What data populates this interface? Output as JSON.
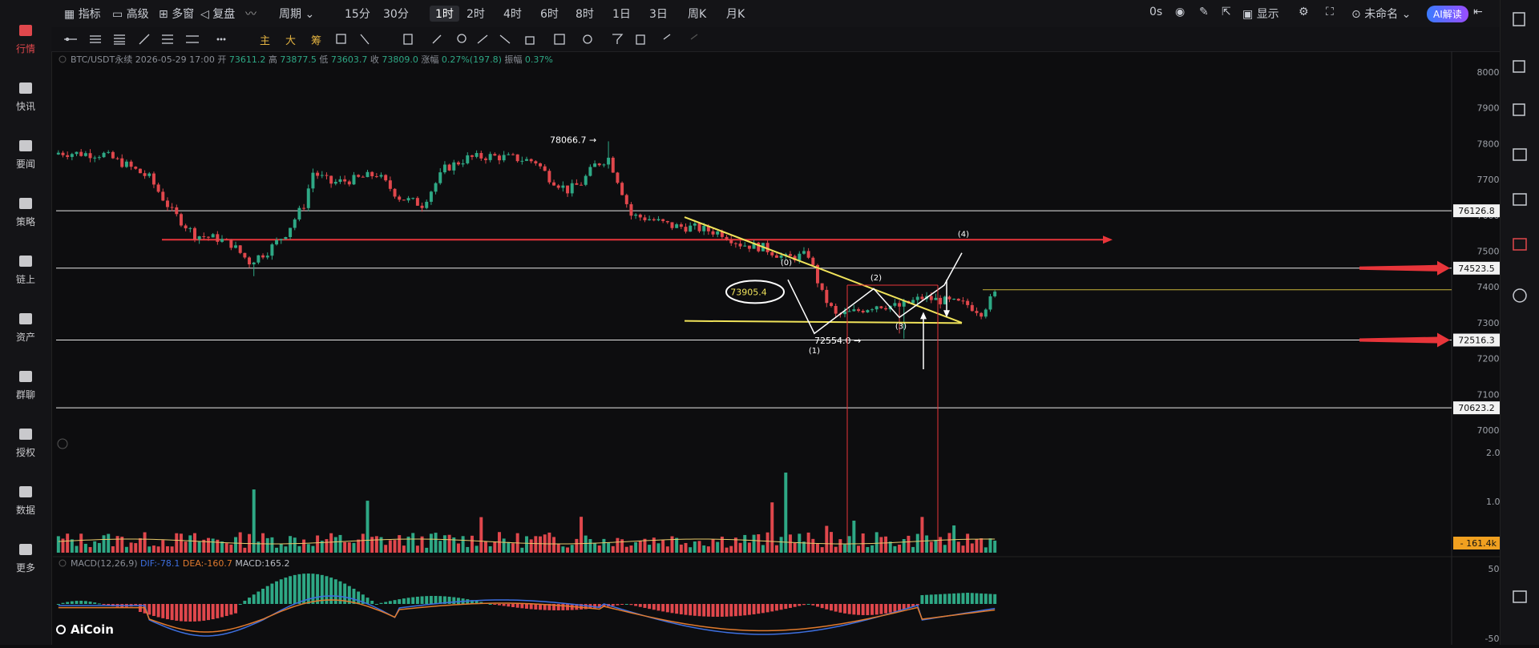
{
  "topbar": {
    "indicators": "指标",
    "advanced": "高级",
    "multi_window": "多窗",
    "replay": "复盘",
    "period_label": "周期",
    "periods": [
      "15分",
      "30分",
      "1时",
      "2时",
      "4时",
      "6时",
      "8时",
      "1日",
      "3日",
      "周K",
      "月K"
    ],
    "selected_period": "1时",
    "time_zero": "0s",
    "display": "显示",
    "unnamed": "未命名",
    "ai_read": "AI解读"
  },
  "nav": [
    {
      "label": "行情",
      "icon": "chart-bars-icon"
    },
    {
      "label": "快讯",
      "icon": "news-flash-icon"
    },
    {
      "label": "要闻",
      "icon": "document-icon"
    },
    {
      "label": "策略",
      "icon": "robot-icon"
    },
    {
      "label": "链上",
      "icon": "chain-icon"
    },
    {
      "label": "资产",
      "icon": "wallet-icon"
    },
    {
      "label": "群聊",
      "icon": "chat-icon"
    },
    {
      "label": "授权",
      "icon": "key-icon"
    },
    {
      "label": "数据",
      "icon": "monitor-icon"
    },
    {
      "label": "更多",
      "icon": "grid-icon"
    }
  ],
  "toolbar2": {
    "main": "主",
    "big": "大",
    "filter": "筹"
  },
  "ohlc": {
    "symbol": "BTC/USDT永续",
    "datetime": "2026-05-29 17:00",
    "open_label": "开",
    "open": "73611.2",
    "high_label": "高",
    "high": "73877.5",
    "low_label": "低",
    "low": "73603.7",
    "close_label": "收",
    "close": "73809.0",
    "change_label": "涨幅",
    "change": "0.27%(197.8)",
    "amp_label": "振幅",
    "amp": "0.37%"
  },
  "price_axis": [
    "80000.0",
    "79000.0",
    "78000.0",
    "77000.0",
    "76000.0",
    "75000.0",
    "74000.0",
    "73000.0",
    "72000.0",
    "71000.0",
    "70000.0"
  ],
  "vol_axis": [
    "2.00M",
    "1.00M"
  ],
  "vol_current": "161.4k",
  "macd_axis": [
    "500.0",
    "0.0",
    "-500.0"
  ],
  "levels": [
    "76126.8",
    "74523.5",
    "72516.3",
    "70623.2"
  ],
  "annotations": {
    "high_mark": "78066.7",
    "circled": "73905.4",
    "low_mark": "72554.0",
    "wave0": "(0)",
    "wave1": "(1)",
    "wave2": "(2)",
    "wave3": "(3)",
    "wave4": "(4)"
  },
  "macd": {
    "title": "MACD(12,26,9)",
    "dif": "DIF:-78.1",
    "dea": "DEA:-160.7",
    "macd": "MACD:165.2"
  },
  "brand": "AiCoin",
  "colors": {
    "up": "#2ea885",
    "down": "#e0474c",
    "yellow": "#f0e35a",
    "accent_red": "#e8353a"
  }
}
